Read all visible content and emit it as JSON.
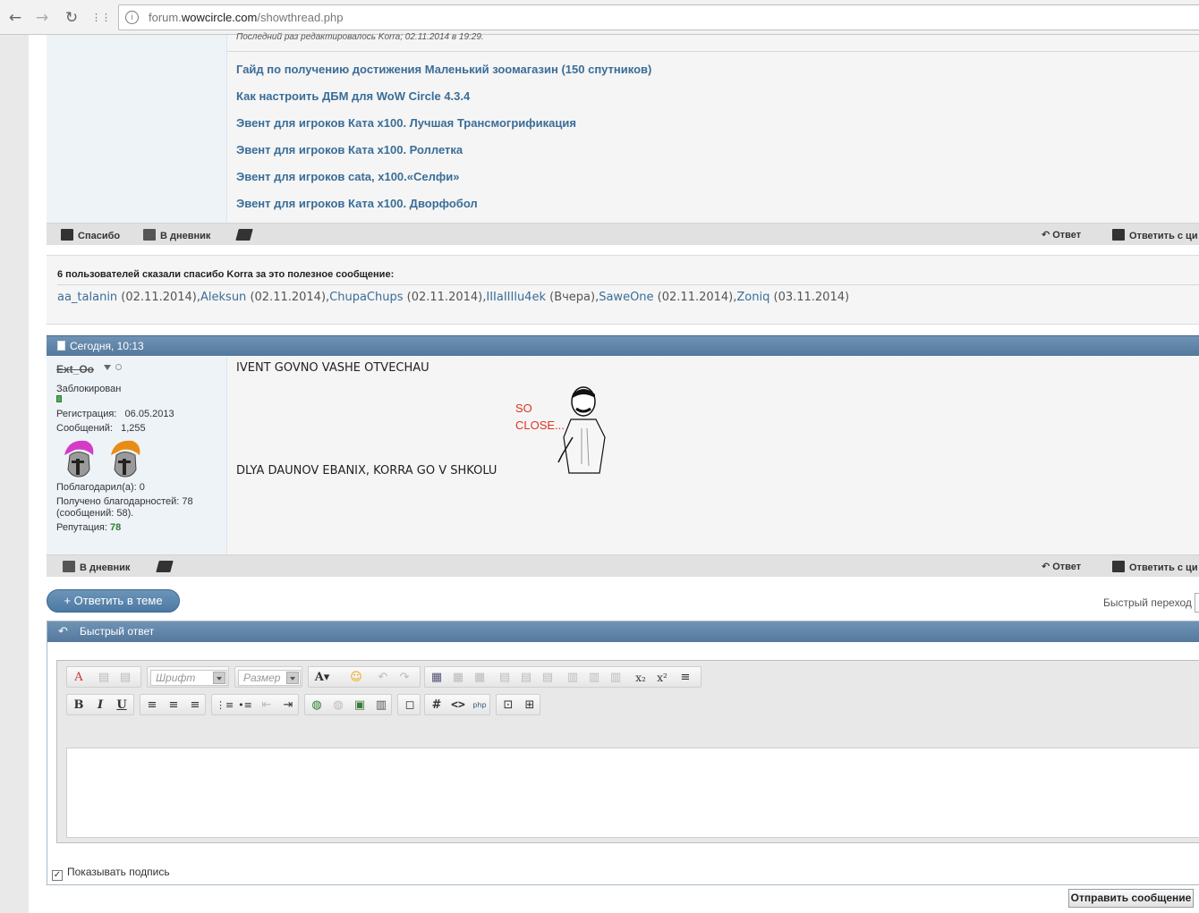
{
  "browser": {
    "url_prefix": "forum.",
    "url_domain": "wowcircle.com",
    "url_path": "/showthread.php",
    "back_icon": "←",
    "forward_icon": "→",
    "reload_icon": "↻",
    "apps_icon": "⋮⋮"
  },
  "post1": {
    "edited_note": "Последний раз редактировалось Korra; 02.11.2014 в 19:29.",
    "links": [
      "Гайд по получению достижения Маленький зоомагазин (150 спутников)",
      "Как настроить ДБМ для WoW Circle 4.3.4",
      "Эвент для игроков Ката x100. Лучшая Трансмогрификация",
      "Эвент для игроков Ката x100. Роллетка",
      "Эвент для игроков cata, x100.«Селфи»",
      "Эвент для игроков Ката x100. Дворфобол"
    ],
    "actions": {
      "thanks": "Спасибо",
      "diary": "В дневник",
      "reply": "Ответ",
      "quote_reply": "Ответить с ци"
    }
  },
  "thanks": {
    "title": "6 пользователей сказали спасибо Korra за это полезное сообщение:",
    "users": [
      {
        "name": "aa_talanin",
        "date": " (02.11.2014),"
      },
      {
        "name": "Aleksun",
        "date": " (02.11.2014),"
      },
      {
        "name": "ChupaChups",
        "date": " (02.11.2014),"
      },
      {
        "name": "IIIaIIIlu4ek",
        "date": " (Вчера),"
      },
      {
        "name": "SaweOne",
        "date": " (02.11.2014),"
      },
      {
        "name": "Zoniq",
        "date": " (03.11.2014)"
      }
    ]
  },
  "post2": {
    "date": "Сегодня, 10:13",
    "user": {
      "name": "Ext_Oo",
      "status": "Заблокирован",
      "reg_label": "Регистрация:",
      "reg_value": "06.05.2013",
      "msg_label": "Сообщений:",
      "msg_value": "1,255",
      "thanked": "Поблагодарил(а):    0",
      "received": "Получено благодарностей: 78 (сообщений: 58).",
      "rep_label": "Репутация: ",
      "rep_value": "78"
    },
    "message_line1": "IVENT GOVNO VASHE OTVECHAU",
    "message_line2": "DLYA DAUNOV EBANIX, KORRA GO V SHKOLU",
    "meme_text_1": "SO",
    "meme_text_2": "CLOSE...",
    "actions": {
      "diary": "В дневник",
      "reply": "Ответ",
      "quote_reply": "Ответить с ци"
    }
  },
  "reply_button": "+ Ответить в теме",
  "quick_jump": "Быстрый переход",
  "quick_reply": {
    "title": "Быстрый ответ",
    "font_placeholder": "Шрифт",
    "size_placeholder": "Размер",
    "show_signature": "Показывать подпись",
    "submit": "Отправить сообщение"
  },
  "colors": {
    "link": "#3a6d97",
    "header": "#6f93b5",
    "rep_green": "#2e7d32"
  }
}
